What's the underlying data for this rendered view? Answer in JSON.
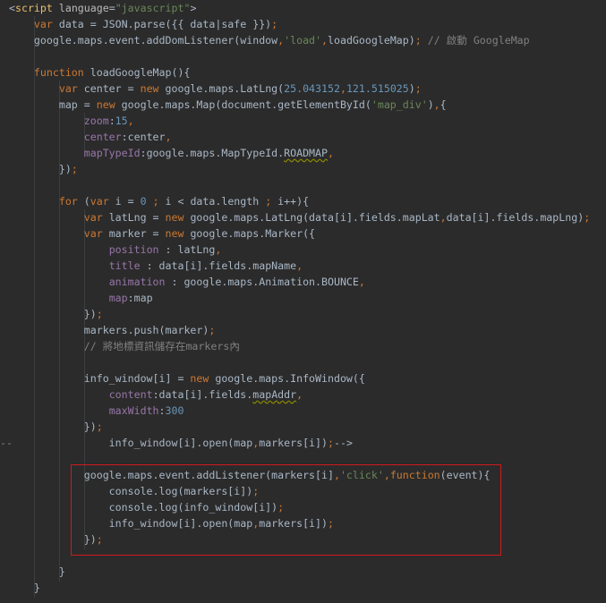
{
  "editor": {
    "language": "javascript",
    "colors": {
      "background": "#2b2b2b",
      "keyword": "#cc7832",
      "string": "#6a8759",
      "number": "#6897bb",
      "property": "#9876aa",
      "comment": "#808080",
      "text": "#a9b7c6",
      "highlight_box": "#d0191e"
    },
    "lines": [
      {
        "tokens": [
          {
            "t": "<",
            "c": "plain"
          },
          {
            "t": "script",
            "c": "tag"
          },
          {
            "t": " ",
            "c": "plain"
          },
          {
            "t": "language",
            "c": "attr"
          },
          {
            "t": "=",
            "c": "plain"
          },
          {
            "t": "\"javascript\"",
            "c": "str"
          },
          {
            "t": ">",
            "c": "plain"
          }
        ]
      },
      {
        "tokens": [
          {
            "t": "    ",
            "c": "plain"
          },
          {
            "t": "var ",
            "c": "kw"
          },
          {
            "t": "data = JSON.parse({{ data|safe }})",
            "c": "plain"
          },
          {
            "t": ";",
            "c": "kw"
          }
        ]
      },
      {
        "tokens": [
          {
            "t": "    google.maps.event.addDomListener(window",
            "c": "plain"
          },
          {
            "t": ",",
            "c": "kw"
          },
          {
            "t": "'load'",
            "c": "str"
          },
          {
            "t": ",",
            "c": "kw"
          },
          {
            "t": "loadGoogleMap)",
            "c": "plain"
          },
          {
            "t": ";",
            "c": "kw"
          },
          {
            "t": " // 啟動 GoogleMap",
            "c": "com"
          }
        ]
      },
      {
        "tokens": []
      },
      {
        "tokens": [
          {
            "t": "    ",
            "c": "plain"
          },
          {
            "t": "function ",
            "c": "kw"
          },
          {
            "t": "loadGoogleMap(){",
            "c": "plain"
          }
        ]
      },
      {
        "tokens": [
          {
            "t": "        ",
            "c": "plain"
          },
          {
            "t": "var ",
            "c": "kw"
          },
          {
            "t": "center = ",
            "c": "plain"
          },
          {
            "t": "new ",
            "c": "kw"
          },
          {
            "t": "google.maps.LatLng(",
            "c": "plain"
          },
          {
            "t": "25.043152",
            "c": "num"
          },
          {
            "t": ",",
            "c": "kw"
          },
          {
            "t": "121.515025",
            "c": "num"
          },
          {
            "t": ")",
            "c": "plain"
          },
          {
            "t": ";",
            "c": "kw"
          }
        ]
      },
      {
        "tokens": [
          {
            "t": "        map = ",
            "c": "plain"
          },
          {
            "t": "new ",
            "c": "kw"
          },
          {
            "t": "google.maps.Map(document.getElementById(",
            "c": "plain"
          },
          {
            "t": "'map_div'",
            "c": "str"
          },
          {
            "t": ")",
            "c": "plain"
          },
          {
            "t": ",",
            "c": "kw"
          },
          {
            "t": "{",
            "c": "plain"
          }
        ]
      },
      {
        "tokens": [
          {
            "t": "            ",
            "c": "plain"
          },
          {
            "t": "zoom",
            "c": "prop"
          },
          {
            "t": ":",
            "c": "plain"
          },
          {
            "t": "15",
            "c": "num"
          },
          {
            "t": ",",
            "c": "kw"
          }
        ]
      },
      {
        "tokens": [
          {
            "t": "            ",
            "c": "plain"
          },
          {
            "t": "center",
            "c": "prop"
          },
          {
            "t": ":center",
            "c": "plain"
          },
          {
            "t": ",",
            "c": "kw"
          }
        ]
      },
      {
        "tokens": [
          {
            "t": "            ",
            "c": "plain"
          },
          {
            "t": "mapTypeId",
            "c": "prop"
          },
          {
            "t": ":google.maps.MapTypeId.",
            "c": "plain"
          },
          {
            "t": "ROADMAP",
            "c": "sq"
          },
          {
            "t": ",",
            "c": "kw"
          }
        ]
      },
      {
        "tokens": [
          {
            "t": "        })",
            "c": "plain"
          },
          {
            "t": ";",
            "c": "kw"
          }
        ]
      },
      {
        "tokens": []
      },
      {
        "tokens": [
          {
            "t": "        ",
            "c": "plain"
          },
          {
            "t": "for ",
            "c": "kw"
          },
          {
            "t": "(",
            "c": "plain"
          },
          {
            "t": "var ",
            "c": "kw"
          },
          {
            "t": "i = ",
            "c": "plain"
          },
          {
            "t": "0",
            "c": "num"
          },
          {
            "t": " ",
            "c": "plain"
          },
          {
            "t": ";",
            "c": "kw"
          },
          {
            "t": " i < data.length ",
            "c": "plain"
          },
          {
            "t": ";",
            "c": "kw"
          },
          {
            "t": " i++){",
            "c": "plain"
          }
        ]
      },
      {
        "tokens": [
          {
            "t": "            ",
            "c": "plain"
          },
          {
            "t": "var ",
            "c": "kw"
          },
          {
            "t": "latLng = ",
            "c": "plain"
          },
          {
            "t": "new ",
            "c": "kw"
          },
          {
            "t": "google.maps.LatLng(data[i].fields.mapLat",
            "c": "plain"
          },
          {
            "t": ",",
            "c": "kw"
          },
          {
            "t": "data[i].fields.mapLng)",
            "c": "plain"
          },
          {
            "t": ";",
            "c": "kw"
          }
        ]
      },
      {
        "tokens": [
          {
            "t": "            ",
            "c": "plain"
          },
          {
            "t": "var ",
            "c": "kw"
          },
          {
            "t": "marker = ",
            "c": "plain"
          },
          {
            "t": "new ",
            "c": "kw"
          },
          {
            "t": "google.maps.Marker({",
            "c": "plain"
          }
        ]
      },
      {
        "tokens": [
          {
            "t": "                ",
            "c": "plain"
          },
          {
            "t": "position",
            "c": "prop"
          },
          {
            "t": " : latLng",
            "c": "plain"
          },
          {
            "t": ",",
            "c": "kw"
          }
        ]
      },
      {
        "tokens": [
          {
            "t": "                ",
            "c": "plain"
          },
          {
            "t": "title",
            "c": "prop"
          },
          {
            "t": " : data[i].fields.mapName",
            "c": "plain"
          },
          {
            "t": ",",
            "c": "kw"
          }
        ]
      },
      {
        "tokens": [
          {
            "t": "                ",
            "c": "plain"
          },
          {
            "t": "animation",
            "c": "prop"
          },
          {
            "t": " : google.maps.Animation.BOUNCE",
            "c": "plain"
          },
          {
            "t": ",",
            "c": "kw"
          }
        ]
      },
      {
        "tokens": [
          {
            "t": "                ",
            "c": "plain"
          },
          {
            "t": "map",
            "c": "prop"
          },
          {
            "t": ":map",
            "c": "plain"
          }
        ]
      },
      {
        "tokens": [
          {
            "t": "            })",
            "c": "plain"
          },
          {
            "t": ";",
            "c": "kw"
          }
        ]
      },
      {
        "tokens": [
          {
            "t": "            markers.push(marker)",
            "c": "plain"
          },
          {
            "t": ";",
            "c": "kw"
          }
        ]
      },
      {
        "tokens": [
          {
            "t": "            ",
            "c": "plain"
          },
          {
            "t": "// 將地標資訊儲存在markers內",
            "c": "com"
          }
        ]
      },
      {
        "tokens": []
      },
      {
        "tokens": [
          {
            "t": "            info_window[i] = ",
            "c": "plain"
          },
          {
            "t": "new ",
            "c": "kw"
          },
          {
            "t": "google.maps.InfoWindow({",
            "c": "plain"
          }
        ]
      },
      {
        "tokens": [
          {
            "t": "                ",
            "c": "plain"
          },
          {
            "t": "content",
            "c": "prop"
          },
          {
            "t": ":data[i].fields.",
            "c": "plain"
          },
          {
            "t": "mapAddr",
            "c": "sq"
          },
          {
            "t": ",",
            "c": "kw"
          }
        ]
      },
      {
        "tokens": [
          {
            "t": "                ",
            "c": "plain"
          },
          {
            "t": "maxWidth",
            "c": "prop"
          },
          {
            "t": ":",
            "c": "plain"
          },
          {
            "t": "300",
            "c": "num"
          }
        ]
      },
      {
        "tokens": [
          {
            "t": "            })",
            "c": "plain"
          },
          {
            "t": ";",
            "c": "kw"
          }
        ]
      },
      {
        "tokens": [
          {
            "t": "                info_window[i].open(map",
            "c": "plain"
          },
          {
            "t": ",",
            "c": "kw"
          },
          {
            "t": "markers[i])",
            "c": "plain"
          },
          {
            "t": ";",
            "c": "kw"
          },
          {
            "t": "-->",
            "c": "plain"
          }
        ],
        "fold_prefix": "--"
      },
      {
        "tokens": []
      },
      {
        "tokens": [
          {
            "t": "            google.maps.event.addListener(markers[i]",
            "c": "plain"
          },
          {
            "t": ",",
            "c": "kw"
          },
          {
            "t": "'click'",
            "c": "str"
          },
          {
            "t": ",",
            "c": "kw"
          },
          {
            "t": "function",
            "c": "kw"
          },
          {
            "t": "(event){",
            "c": "plain"
          }
        ]
      },
      {
        "tokens": [
          {
            "t": "                console.log(markers[i])",
            "c": "plain"
          },
          {
            "t": ";",
            "c": "kw"
          }
        ]
      },
      {
        "tokens": [
          {
            "t": "                console.log(info_window[i])",
            "c": "plain"
          },
          {
            "t": ";",
            "c": "kw"
          }
        ]
      },
      {
        "tokens": [
          {
            "t": "                info_window[i].open(map",
            "c": "plain"
          },
          {
            "t": ",",
            "c": "kw"
          },
          {
            "t": "markers[i])",
            "c": "plain"
          },
          {
            "t": ";",
            "c": "kw"
          }
        ]
      },
      {
        "tokens": [
          {
            "t": "            })",
            "c": "plain"
          },
          {
            "t": ";",
            "c": "kw"
          }
        ]
      },
      {
        "tokens": []
      },
      {
        "tokens": [
          {
            "t": "        }",
            "c": "plain"
          }
        ]
      },
      {
        "tokens": [
          {
            "t": "    }",
            "c": "plain"
          }
        ]
      }
    ]
  }
}
